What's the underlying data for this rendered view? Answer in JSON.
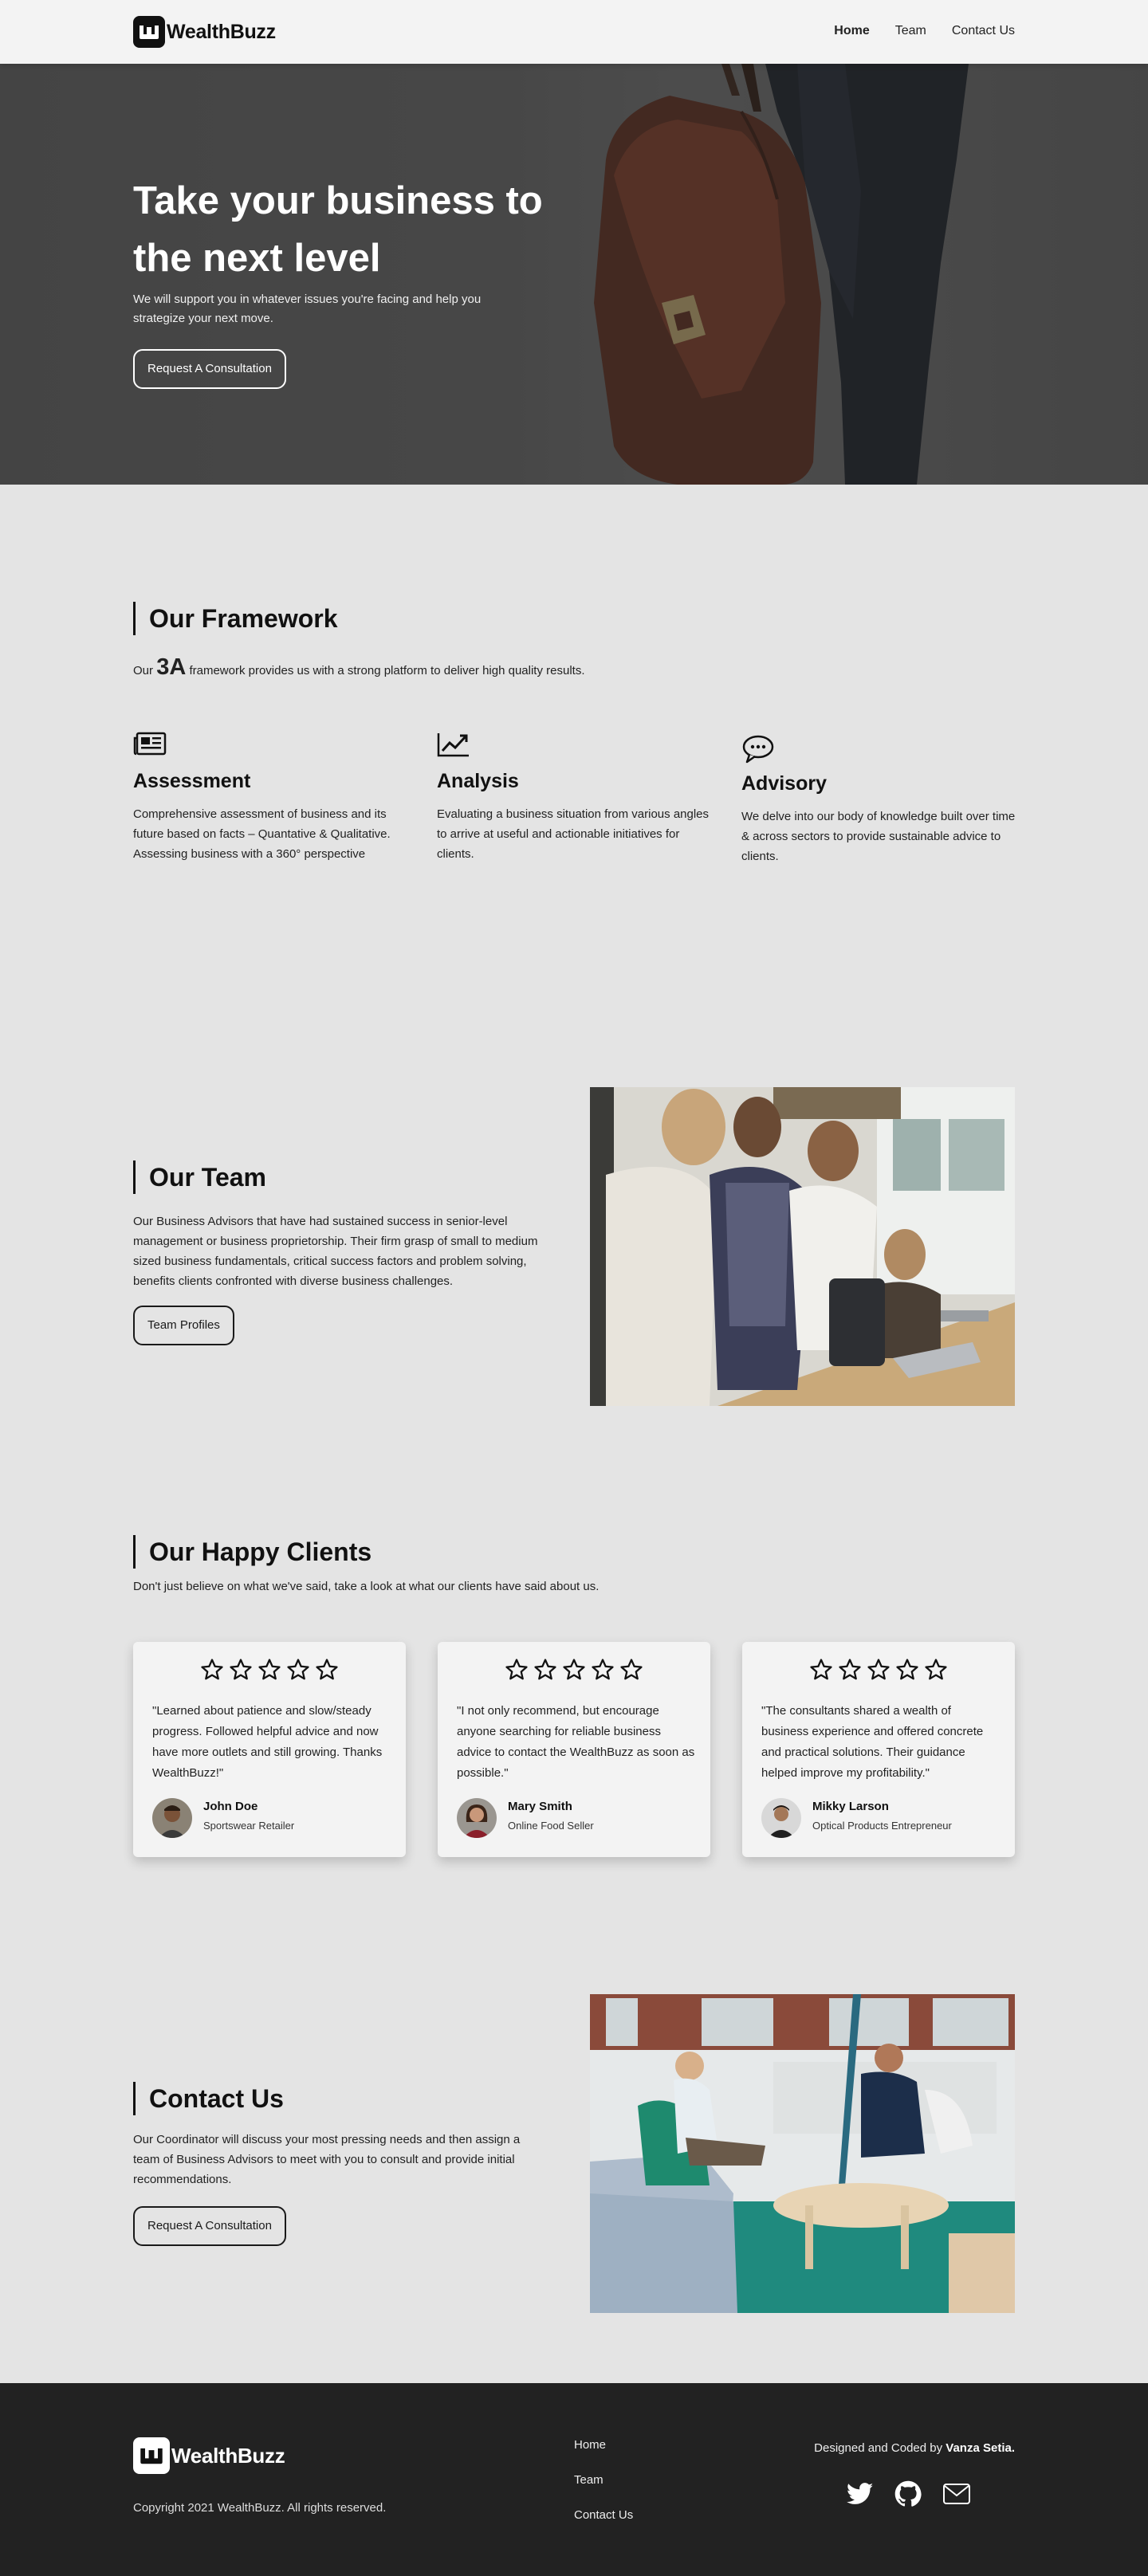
{
  "brand": {
    "name": "WealthBuzz",
    "logo_letter": "W"
  },
  "nav": {
    "items": [
      "Home",
      "Team",
      "Contact Us"
    ],
    "active": "Home"
  },
  "hero": {
    "title": "Take your business to the next level",
    "subtitle": "We will support you in whatever issues you're facing and help you strategize your next move.",
    "cta": "Request A Consultation"
  },
  "framework": {
    "title": "Our Framework",
    "intro_prefix": "Our",
    "intro_highlight": "3A",
    "intro_suffix": "framework provides us with a strong platform to deliver high quality results.",
    "items": [
      {
        "icon": "newspaper-icon",
        "title": "Assessment",
        "text": "Comprehensive assessment of business and its future based on facts – Quantative & Qualitative. Assessing business with a 360° perspective"
      },
      {
        "icon": "chart-line-icon",
        "title": "Analysis",
        "text": "Evaluating a business situation from various angles to arrive at useful and actionable initiatives for clients."
      },
      {
        "icon": "speech-bubble-icon",
        "title": "Advisory",
        "text": "We delve into our body of knowledge built over time & across sectors to provide sustainable advice to clients."
      }
    ]
  },
  "team": {
    "title": "Our Team",
    "text": "Our Business Advisors that have had sustained success in senior-level management or business proprietorship. Their firm grasp of small to medium sized business fundamentals, critical success factors and problem solving, benefits clients confronted with diverse business challenges.",
    "cta": "Team Profiles"
  },
  "clients": {
    "title": "Our Happy Clients",
    "intro": "Don't just believe on what we've said, take a look at what our clients have said about us.",
    "testimonials": [
      {
        "stars": 5,
        "quote": "\"Learned about patience and slow/steady progress. Followed helpful advice and now have more outlets and still growing. Thanks WealthBuzz!\"",
        "name": "John Doe",
        "role": "Sportswear Retailer"
      },
      {
        "stars": 5,
        "quote": "\"I not only recommend, but encourage anyone searching for reliable business advice to contact the WealthBuzz as soon as possible.\"",
        "name": "Mary Smith",
        "role": "Online Food Seller"
      },
      {
        "stars": 5,
        "quote": "\"The consultants shared a wealth of business experience and offered concrete and practical solutions. Their guidance helped improve my profitability.\"",
        "name": "Mikky Larson",
        "role": "Optical Products Entrepreneur"
      }
    ]
  },
  "contact": {
    "title": "Contact Us",
    "text": "Our Coordinator will discuss your most pressing needs and then assign a team of Business Advisors to meet with you to consult and provide initial recommendations.",
    "cta": "Request A Consultation"
  },
  "footer": {
    "copyright": "Copyright 2021 WealthBuzz. All rights reserved.",
    "links": [
      "Home",
      "Team",
      "Contact Us"
    ],
    "credit_prefix": "Designed and Coded by",
    "credit_name": "Vanza Setia.",
    "socials": [
      "twitter-icon",
      "github-icon",
      "mail-icon"
    ]
  },
  "colors": {
    "background": "#e4e4e4",
    "nav": "#f3f3f3",
    "footer": "#222222",
    "text": "#1f1f1f"
  }
}
